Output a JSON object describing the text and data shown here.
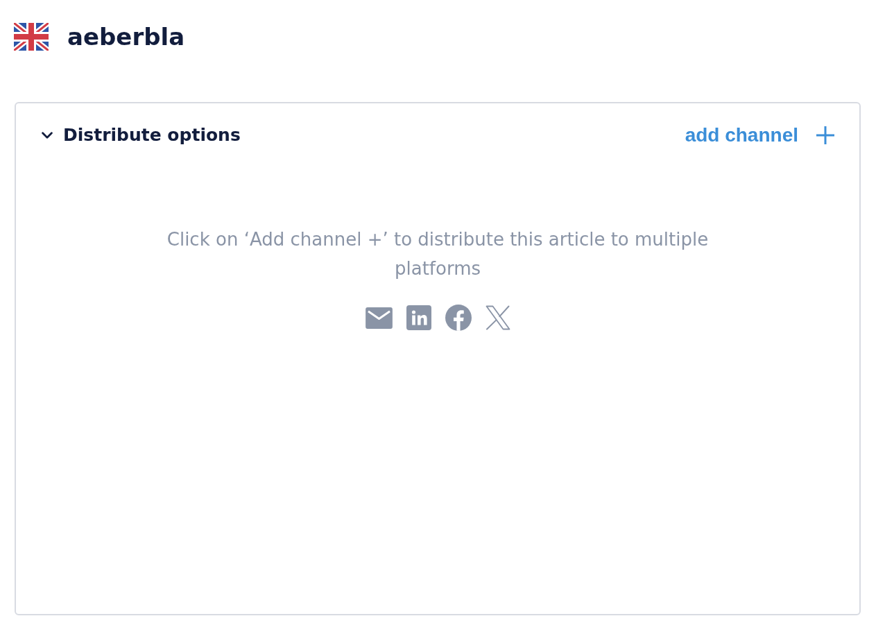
{
  "header": {
    "title": "aeberbla"
  },
  "panel": {
    "title": "Distribute options",
    "expanded": true,
    "add_button": "add channel",
    "empty_message": "Click on ‘Add channel +’ to distribute this article to multiple platforms",
    "channel_icons": [
      {
        "kind": "email"
      },
      {
        "kind": "linkedin"
      },
      {
        "kind": "facebook"
      },
      {
        "kind": "x"
      }
    ]
  }
}
